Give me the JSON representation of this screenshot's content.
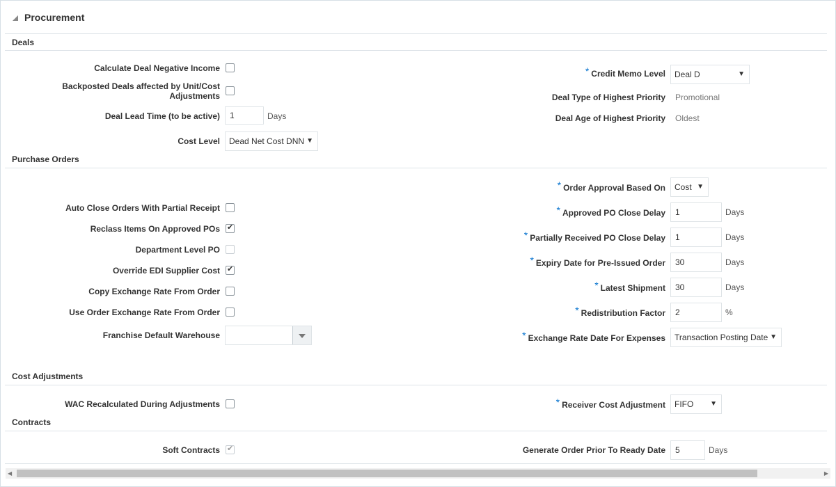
{
  "panel": {
    "title": "Procurement"
  },
  "sections": {
    "deals": "Deals",
    "purchase_orders": "Purchase Orders",
    "cost_adjustments": "Cost Adjustments",
    "contracts": "Contracts"
  },
  "deals": {
    "calc_neg_income": {
      "label": "Calculate Deal Negative Income",
      "checked": false
    },
    "backposted_line1": "Backposted Deals affected by Unit/Cost",
    "backposted_line2": "Adjustments",
    "backposted_checked": false,
    "lead_time": {
      "label": "Deal Lead Time (to be active)",
      "value": "1",
      "unit": "Days"
    },
    "cost_level": {
      "label": "Cost Level",
      "value": "Dead Net Cost DNN"
    },
    "credit_memo": {
      "label": "Credit Memo Level",
      "value": "Deal D"
    },
    "type_priority": {
      "label": "Deal Type of Highest Priority",
      "value": "Promotional"
    },
    "age_priority": {
      "label": "Deal Age of Highest Priority",
      "value": "Oldest"
    }
  },
  "po": {
    "auto_close": {
      "label": "Auto Close Orders With Partial Receipt",
      "checked": false
    },
    "reclass": {
      "label": "Reclass Items On Approved POs",
      "checked": true
    },
    "dept_level": {
      "label": "Department Level PO",
      "checked": false
    },
    "override_edi": {
      "label": "Override EDI Supplier Cost",
      "checked": true
    },
    "copy_exch": {
      "label": "Copy Exchange Rate From Order",
      "checked": false
    },
    "use_order_exch": {
      "label": "Use Order Exchange Rate From Order",
      "checked": false
    },
    "franchise_wh": {
      "label": "Franchise Default Warehouse",
      "value": ""
    },
    "approval_based": {
      "label": "Order Approval Based On",
      "value": "Cost"
    },
    "approved_close": {
      "label": "Approved PO Close Delay",
      "value": "1",
      "unit": "Days"
    },
    "partial_close": {
      "label": "Partially Received PO Close Delay",
      "value": "1",
      "unit": "Days"
    },
    "expiry": {
      "label": "Expiry Date for Pre-Issued Order",
      "value": "30",
      "unit": "Days"
    },
    "latest_ship": {
      "label": "Latest Shipment",
      "value": "30",
      "unit": "Days"
    },
    "redistribution": {
      "label": "Redistribution Factor",
      "value": "2",
      "unit": "%"
    },
    "exch_date": {
      "label": "Exchange Rate Date For Expenses",
      "value": "Transaction Posting Date"
    }
  },
  "cost_adj": {
    "wac": {
      "label": "WAC Recalculated During Adjustments",
      "checked": false
    },
    "receiver": {
      "label": "Receiver Cost Adjustment",
      "value": "FIFO"
    }
  },
  "contracts": {
    "soft": {
      "label": "Soft Contracts",
      "checked": true
    },
    "gen_order": {
      "label": "Generate Order Prior To Ready Date",
      "value": "5",
      "unit": "Days"
    }
  },
  "required_marker": "*",
  "check_glyph": "✔",
  "dropdown_glyph": "▼",
  "colors": {
    "required": "#0572ce",
    "border": "#dfe4e7",
    "text": "#333333"
  }
}
